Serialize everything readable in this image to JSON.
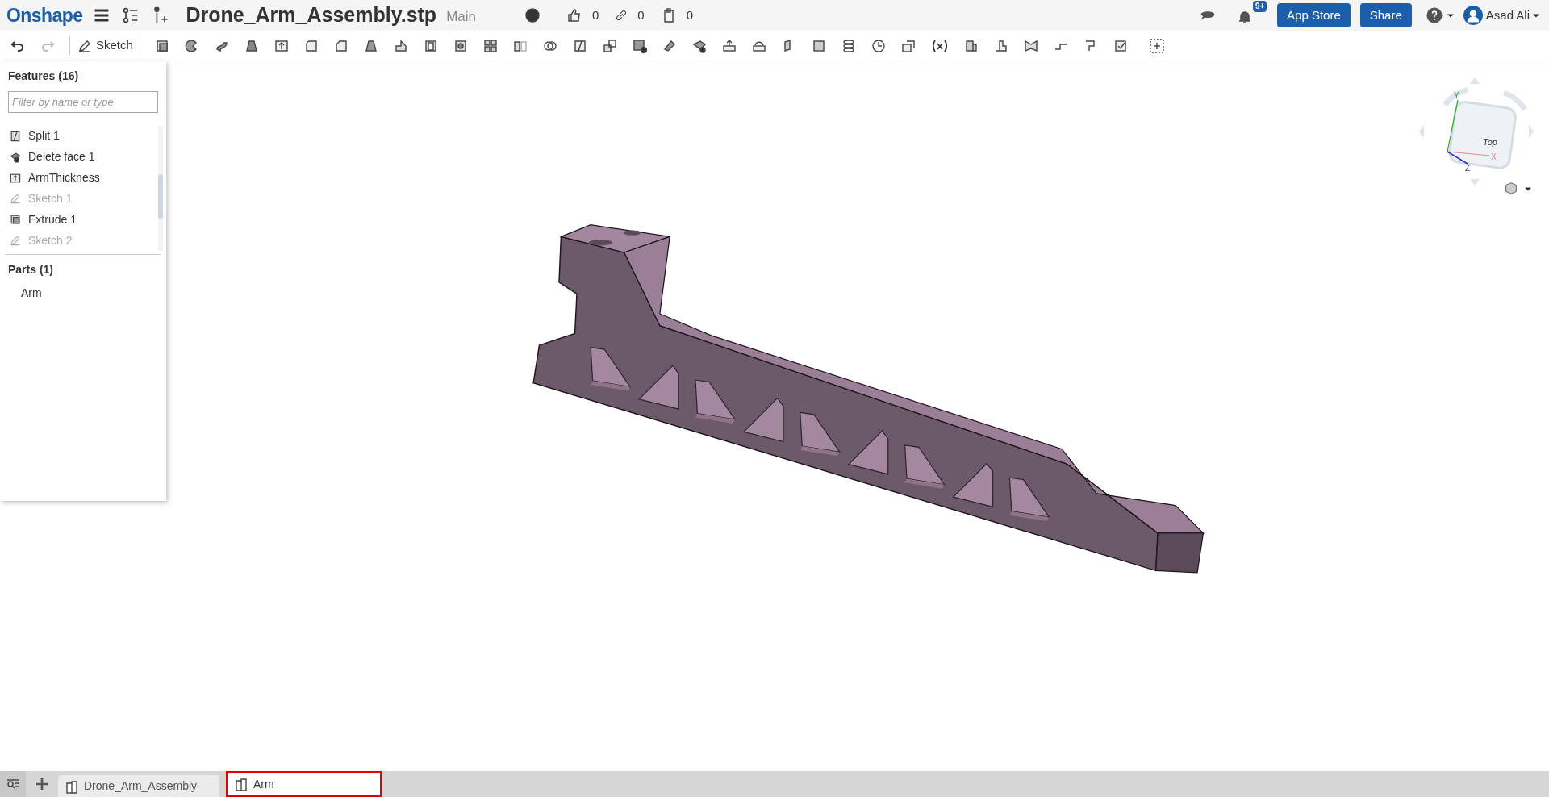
{
  "header": {
    "logo": "Onshape",
    "document_title": "Drone_Arm_Assembly.stp",
    "branch": "Main",
    "likes": "0",
    "links": "0",
    "copies": "0",
    "notification_badge": "9+",
    "buttons": [
      "App Store",
      "Share"
    ],
    "user": "Asad Ali"
  },
  "toolbar": {
    "sketch_label": "Sketch"
  },
  "features_panel": {
    "title": "Features (16)",
    "filter": {
      "placeholder": "Filter by name or type"
    },
    "items": [
      {
        "label": "Split 1",
        "kind": "split"
      },
      {
        "label": "Delete face 1",
        "kind": "delete"
      },
      {
        "label": "ArmThickness",
        "kind": "variable"
      },
      {
        "label": "Sketch 1",
        "kind": "sketch"
      },
      {
        "label": "Extrude 1",
        "kind": "extrude"
      },
      {
        "label": "Sketch 2",
        "kind": "sketch"
      }
    ]
  },
  "parts_panel": {
    "title": "Parts (1)",
    "items": [
      "Arm"
    ]
  },
  "view_cube": {
    "face": "Top",
    "axes": {
      "x": "X",
      "y": "Y",
      "z": "Z"
    }
  },
  "tabs": [
    {
      "label": "Drone_Arm_Assembly",
      "selected": false
    },
    {
      "label": "Arm",
      "selected": true
    }
  ]
}
